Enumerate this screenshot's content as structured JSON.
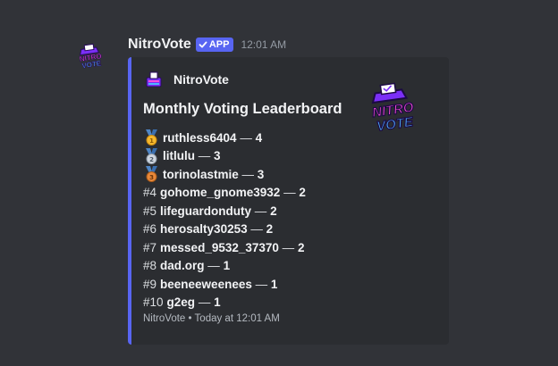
{
  "message": {
    "username": "NitroVote",
    "app_badge": "APP",
    "timestamp": "12:01 AM",
    "avatar_icon": "nitrovote-logo-icon"
  },
  "embed": {
    "accent_color": "#5865f2",
    "author": "NitroVote",
    "author_icon": "nitrovote-ballot-icon",
    "title": "Monthly Voting Leaderboard",
    "thumbnail_text": [
      "NITRO",
      "VOTE"
    ],
    "thumbnail_icon": "nitrovote-logo-icon",
    "leaderboard": [
      {
        "rank": "",
        "medal": "gold-medal-icon",
        "name": "ruthless6404",
        "score": "4"
      },
      {
        "rank": "",
        "medal": "silver-medal-icon",
        "name": "litlulu",
        "score": "3"
      },
      {
        "rank": "",
        "medal": "bronze-medal-icon",
        "name": "torinolastmie",
        "score": "3"
      },
      {
        "rank": "#4",
        "medal": "",
        "name": "gohome_gnome3932",
        "score": "2"
      },
      {
        "rank": "#5",
        "medal": "",
        "name": "lifeguardonduty",
        "score": "2"
      },
      {
        "rank": "#6",
        "medal": "",
        "name": "herosalty30253",
        "score": "2"
      },
      {
        "rank": "#7",
        "medal": "",
        "name": "messed_9532_37370",
        "score": "2"
      },
      {
        "rank": "#8",
        "medal": "",
        "name": "dad.org",
        "score": "1"
      },
      {
        "rank": "#9",
        "medal": "",
        "name": "beeneeweenees",
        "score": "1"
      },
      {
        "rank": "#10",
        "medal": "",
        "name": "g2eg",
        "score": "1"
      }
    ],
    "separator": "—",
    "footer": {
      "name": "NitroVote",
      "dot": "•",
      "time": "Today at 12:01 AM"
    }
  }
}
